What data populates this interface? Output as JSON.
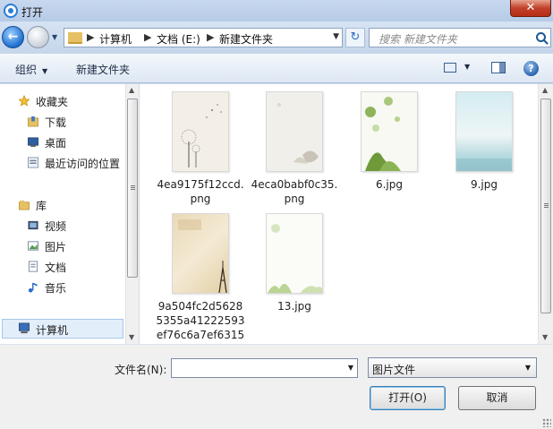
{
  "window": {
    "title": "打开",
    "close_glyph": "✕"
  },
  "nav": {
    "back_glyph": "←",
    "history_glyph": "▼",
    "address": {
      "segments": [
        "计算机",
        "文档 (E:)",
        "新建文件夹"
      ],
      "separator": "▶",
      "dropdown_glyph": "▼"
    },
    "refresh_glyph": "↻",
    "search_placeholder": "搜索 新建文件夹"
  },
  "toolbar": {
    "organize_label": "组织",
    "organize_caret": "▼",
    "new_folder_label": "新建文件夹",
    "view_caret": "▼",
    "help_glyph": "?"
  },
  "sidebar": {
    "favorites_title": "收藏夹",
    "favorites": [
      {
        "label": "下载",
        "icon": "download-folder-icon"
      },
      {
        "label": "桌面",
        "icon": "desktop-icon"
      },
      {
        "label": "最近访问的位置",
        "icon": "recent-places-icon"
      }
    ],
    "libraries_title": "库",
    "libraries": [
      {
        "label": "视频",
        "icon": "video-library-icon"
      },
      {
        "label": "图片",
        "icon": "picture-library-icon"
      },
      {
        "label": "文档",
        "icon": "documents-library-icon"
      },
      {
        "label": "音乐",
        "icon": "music-library-icon"
      }
    ],
    "computer_label": "计算机"
  },
  "files": [
    {
      "name_lines": [
        "4ea9175f12ccd.",
        "png"
      ],
      "icon": "dandelion-image-thumbnail"
    },
    {
      "name_lines": [
        "4eca0babf0c35.",
        "png"
      ],
      "icon": "ink-floral-image-thumbnail"
    },
    {
      "name_lines": [
        "6.jpg"
      ],
      "icon": "green-flowers-image-thumbnail"
    },
    {
      "name_lines": [
        "9.jpg"
      ],
      "icon": "sky-sea-image-thumbnail"
    },
    {
      "name_lines": [
        "9a504fc2d5628",
        "5355a41222593",
        "ef76c6a7ef6315"
      ],
      "icon": "eiffel-tower-image-thumbnail"
    },
    {
      "name_lines": [
        "13.jpg"
      ],
      "icon": "green-plant-image-thumbnail"
    }
  ],
  "footer": {
    "filename_label": "文件名(N):",
    "filename_value": "",
    "filetype_value": "图片文件",
    "open_label": "打开(O)",
    "cancel_label": "取消",
    "caret_glyph": "▼"
  },
  "scroll": {
    "up_glyph": "▲",
    "down_glyph": "▼"
  }
}
